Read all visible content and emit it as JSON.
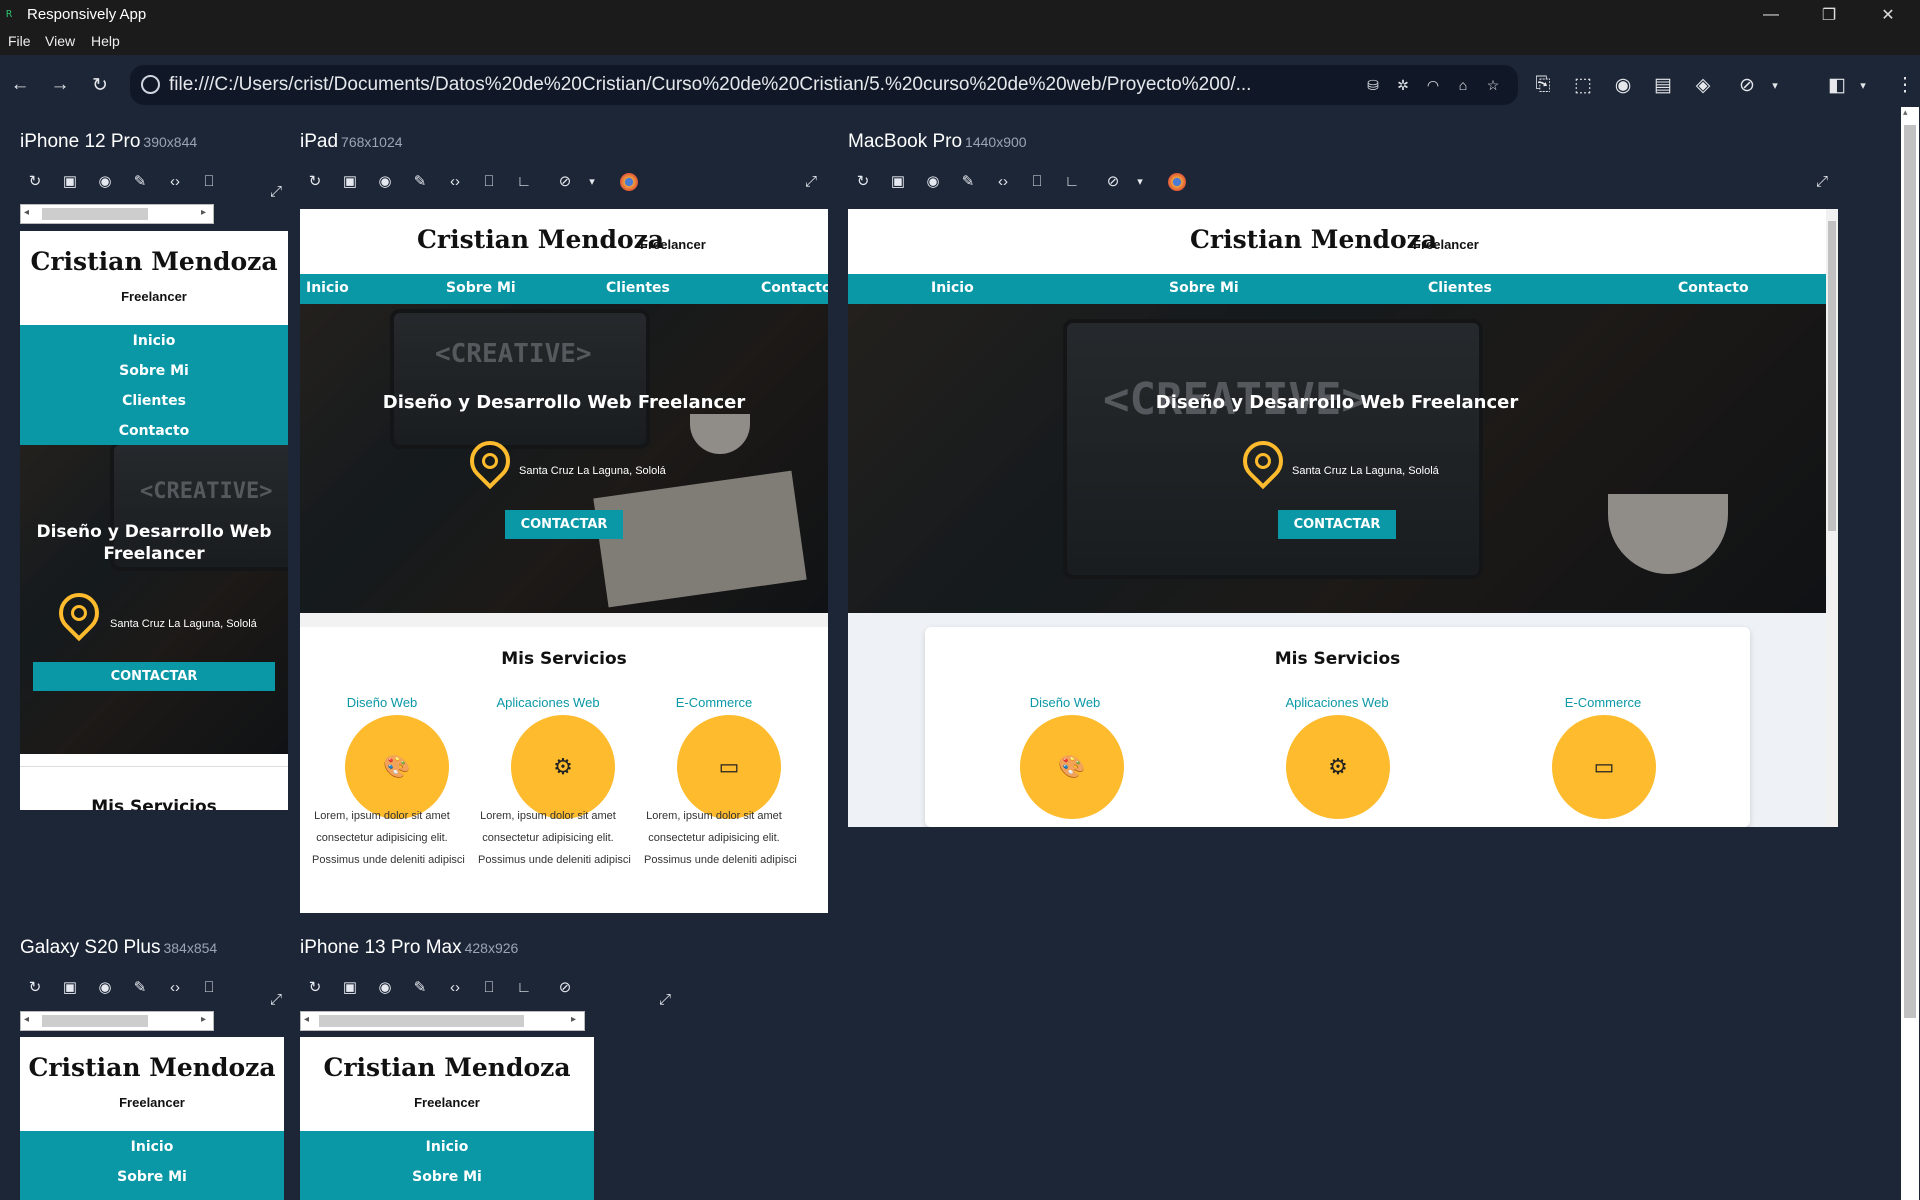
{
  "app": {
    "title": "Responsively App",
    "menu": [
      "File",
      "View",
      "Help"
    ],
    "url": "file:///C:/Users/crist/Documents/Datos%20de%20Cristian/Curso%20de%20Cristian/5.%20curso%20de%20web/Proyecto%200/..."
  },
  "devices": [
    {
      "name": "iPhone 12 Pro",
      "size": "390x844"
    },
    {
      "name": "iPad",
      "size": "768x1024"
    },
    {
      "name": "MacBook Pro",
      "size": "1440x900"
    },
    {
      "name": "Galaxy S20 Plus",
      "size": "384x854"
    },
    {
      "name": "iPhone 13 Pro Max",
      "size": "428x926"
    }
  ],
  "site": {
    "brand": "Cristian Mendoza",
    "tagline": "Freelancer",
    "nav": [
      "Inicio",
      "Sobre Mi",
      "Clientes",
      "Contacto"
    ],
    "hero_title": "Diseño y Desarrollo Web Freelancer",
    "location": "Santa Cruz La Laguna, Sololá",
    "cta": "CONTACTAR",
    "creative_text": "<CREATIVE>",
    "services_title": "Mis Servicios",
    "services": [
      "Diseño Web",
      "Aplicaciones Web",
      "E-Commerce"
    ],
    "lorem": [
      "Lorem, ipsum dolor sit amet",
      "consectetur adipisicing elit.",
      "Possimus unde deleniti adipisci"
    ]
  },
  "colors": {
    "teal": "#0b98a6",
    "yellow": "#fdbb2d",
    "app_bg": "#1c2636"
  }
}
